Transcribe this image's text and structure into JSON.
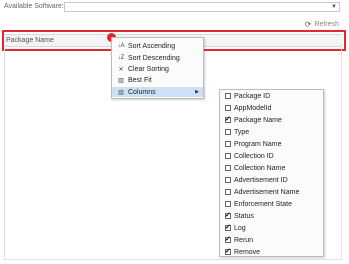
{
  "top": {
    "available_label": "Available Software:",
    "available_value": "",
    "dropdown_icon": "chevron-down-icon"
  },
  "toolbar": {
    "refresh_label": "Refresh",
    "refresh_icon": "refresh-icon"
  },
  "grid": {
    "column_header": "Package Name",
    "highlight_color": "#e4262e"
  },
  "context_menu": {
    "items": [
      {
        "label": "Sort Ascending",
        "icon": "sort-ascending-icon"
      },
      {
        "label": "Sort Descending",
        "icon": "sort-descending-icon"
      },
      {
        "label": "Clear Sorting",
        "icon": "clear-sorting-icon"
      },
      {
        "label": "Best Fit",
        "icon": "best-fit-icon"
      },
      {
        "label": "Columns",
        "icon": "columns-icon",
        "has_submenu": true
      }
    ]
  },
  "columns_menu": {
    "items": [
      {
        "label": "Package ID",
        "checked": false
      },
      {
        "label": "AppModelId",
        "checked": false
      },
      {
        "label": "Package Name",
        "checked": true
      },
      {
        "label": "Type",
        "checked": false
      },
      {
        "label": "Program Name",
        "checked": false
      },
      {
        "label": "Collection ID",
        "checked": false
      },
      {
        "label": "Collection Name",
        "checked": false
      },
      {
        "label": "Advertisement ID",
        "checked": false
      },
      {
        "label": "Advertisement Name",
        "checked": false
      },
      {
        "label": "Enforcement State",
        "checked": false
      },
      {
        "label": "Status",
        "checked": true
      },
      {
        "label": "Log",
        "checked": true
      },
      {
        "label": "Rerun",
        "checked": true
      },
      {
        "label": "Remove",
        "checked": true
      }
    ]
  }
}
